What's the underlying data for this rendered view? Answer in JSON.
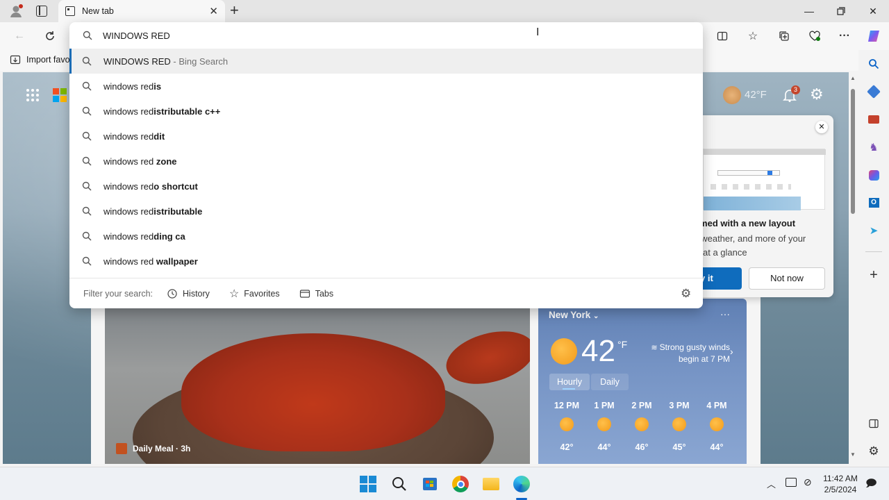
{
  "tab": {
    "title": "New tab"
  },
  "address": {
    "query": "WINDOWS RED"
  },
  "favorites_bar": {
    "import_label": "Import favo"
  },
  "suggestions": [
    {
      "prefix": "WINDOWS RED",
      "bold": "",
      "hint": " - Bing Search"
    },
    {
      "prefix": "windows red",
      "bold": "is",
      "hint": ""
    },
    {
      "prefix": "windows red",
      "bold": "istributable c++",
      "hint": ""
    },
    {
      "prefix": "windows red",
      "bold": "dit",
      "hint": ""
    },
    {
      "prefix": "windows red ",
      "bold": "zone",
      "hint": ""
    },
    {
      "prefix": "windows red",
      "bold": "o shortcut",
      "hint": ""
    },
    {
      "prefix": "windows red",
      "bold": "istributable",
      "hint": ""
    },
    {
      "prefix": "windows red",
      "bold": "ding ca",
      "hint": ""
    },
    {
      "prefix": "windows red ",
      "bold": "wallpaper",
      "hint": ""
    }
  ],
  "filter": {
    "label": "Filter your search:",
    "history": "History",
    "favorites": "Favorites",
    "tabs": "Tabs"
  },
  "header": {
    "temp": "42°F",
    "notif_count": "3"
  },
  "promo": {
    "title": "rmed with a new layout",
    "body1": ", weather, and more of your",
    "body2": "at a glance",
    "try_label": "y it",
    "not_now_label": "Not now"
  },
  "weather": {
    "city": "New York",
    "temp": "42",
    "unit": "°F",
    "alert_line1": "Strong gusty winds",
    "alert_line2": "begin at 7 PM",
    "tab_hourly": "Hourly",
    "tab_daily": "Daily",
    "hours": [
      {
        "time": "12 PM",
        "temp": "42°"
      },
      {
        "time": "1 PM",
        "temp": "44°"
      },
      {
        "time": "2 PM",
        "temp": "46°"
      },
      {
        "time": "3 PM",
        "temp": "45°"
      },
      {
        "time": "4 PM",
        "temp": "44°"
      }
    ]
  },
  "news": {
    "source": "Daily Meal · 3h"
  },
  "taskbar": {
    "time": "11:42 AM",
    "date": "2/5/2024"
  },
  "colors": {
    "accent": "#1b6cb5",
    "edge_blue": "#0c64c8"
  }
}
